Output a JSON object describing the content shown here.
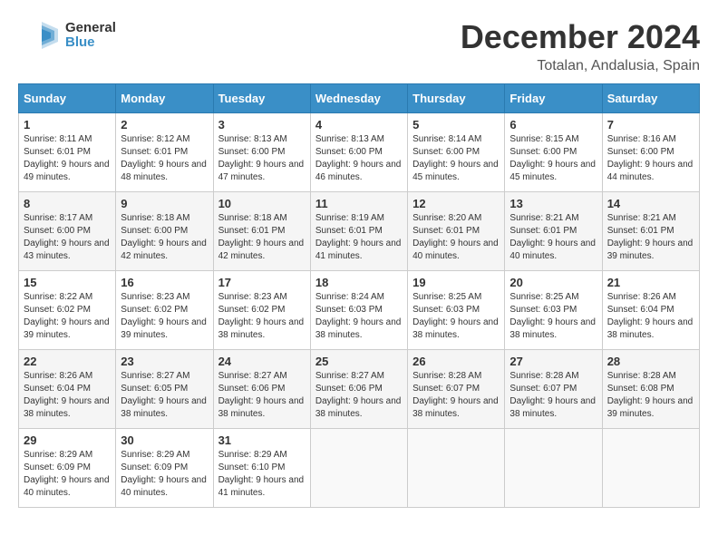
{
  "header": {
    "logo_general": "General",
    "logo_blue": "Blue",
    "month": "December 2024",
    "location": "Totalan, Andalusia, Spain"
  },
  "weekdays": [
    "Sunday",
    "Monday",
    "Tuesday",
    "Wednesday",
    "Thursday",
    "Friday",
    "Saturday"
  ],
  "weeks": [
    [
      {
        "day": "1",
        "sunrise": "8:11 AM",
        "sunset": "6:01 PM",
        "daylight": "9 hours and 49 minutes."
      },
      {
        "day": "2",
        "sunrise": "8:12 AM",
        "sunset": "6:01 PM",
        "daylight": "9 hours and 48 minutes."
      },
      {
        "day": "3",
        "sunrise": "8:13 AM",
        "sunset": "6:00 PM",
        "daylight": "9 hours and 47 minutes."
      },
      {
        "day": "4",
        "sunrise": "8:13 AM",
        "sunset": "6:00 PM",
        "daylight": "9 hours and 46 minutes."
      },
      {
        "day": "5",
        "sunrise": "8:14 AM",
        "sunset": "6:00 PM",
        "daylight": "9 hours and 45 minutes."
      },
      {
        "day": "6",
        "sunrise": "8:15 AM",
        "sunset": "6:00 PM",
        "daylight": "9 hours and 45 minutes."
      },
      {
        "day": "7",
        "sunrise": "8:16 AM",
        "sunset": "6:00 PM",
        "daylight": "9 hours and 44 minutes."
      }
    ],
    [
      {
        "day": "8",
        "sunrise": "8:17 AM",
        "sunset": "6:00 PM",
        "daylight": "9 hours and 43 minutes."
      },
      {
        "day": "9",
        "sunrise": "8:18 AM",
        "sunset": "6:00 PM",
        "daylight": "9 hours and 42 minutes."
      },
      {
        "day": "10",
        "sunrise": "8:18 AM",
        "sunset": "6:01 PM",
        "daylight": "9 hours and 42 minutes."
      },
      {
        "day": "11",
        "sunrise": "8:19 AM",
        "sunset": "6:01 PM",
        "daylight": "9 hours and 41 minutes."
      },
      {
        "day": "12",
        "sunrise": "8:20 AM",
        "sunset": "6:01 PM",
        "daylight": "9 hours and 40 minutes."
      },
      {
        "day": "13",
        "sunrise": "8:21 AM",
        "sunset": "6:01 PM",
        "daylight": "9 hours and 40 minutes."
      },
      {
        "day": "14",
        "sunrise": "8:21 AM",
        "sunset": "6:01 PM",
        "daylight": "9 hours and 39 minutes."
      }
    ],
    [
      {
        "day": "15",
        "sunrise": "8:22 AM",
        "sunset": "6:02 PM",
        "daylight": "9 hours and 39 minutes."
      },
      {
        "day": "16",
        "sunrise": "8:23 AM",
        "sunset": "6:02 PM",
        "daylight": "9 hours and 39 minutes."
      },
      {
        "day": "17",
        "sunrise": "8:23 AM",
        "sunset": "6:02 PM",
        "daylight": "9 hours and 38 minutes."
      },
      {
        "day": "18",
        "sunrise": "8:24 AM",
        "sunset": "6:03 PM",
        "daylight": "9 hours and 38 minutes."
      },
      {
        "day": "19",
        "sunrise": "8:25 AM",
        "sunset": "6:03 PM",
        "daylight": "9 hours and 38 minutes."
      },
      {
        "day": "20",
        "sunrise": "8:25 AM",
        "sunset": "6:03 PM",
        "daylight": "9 hours and 38 minutes."
      },
      {
        "day": "21",
        "sunrise": "8:26 AM",
        "sunset": "6:04 PM",
        "daylight": "9 hours and 38 minutes."
      }
    ],
    [
      {
        "day": "22",
        "sunrise": "8:26 AM",
        "sunset": "6:04 PM",
        "daylight": "9 hours and 38 minutes."
      },
      {
        "day": "23",
        "sunrise": "8:27 AM",
        "sunset": "6:05 PM",
        "daylight": "9 hours and 38 minutes."
      },
      {
        "day": "24",
        "sunrise": "8:27 AM",
        "sunset": "6:06 PM",
        "daylight": "9 hours and 38 minutes."
      },
      {
        "day": "25",
        "sunrise": "8:27 AM",
        "sunset": "6:06 PM",
        "daylight": "9 hours and 38 minutes."
      },
      {
        "day": "26",
        "sunrise": "8:28 AM",
        "sunset": "6:07 PM",
        "daylight": "9 hours and 38 minutes."
      },
      {
        "day": "27",
        "sunrise": "8:28 AM",
        "sunset": "6:07 PM",
        "daylight": "9 hours and 38 minutes."
      },
      {
        "day": "28",
        "sunrise": "8:28 AM",
        "sunset": "6:08 PM",
        "daylight": "9 hours and 39 minutes."
      }
    ],
    [
      {
        "day": "29",
        "sunrise": "8:29 AM",
        "sunset": "6:09 PM",
        "daylight": "9 hours and 40 minutes."
      },
      {
        "day": "30",
        "sunrise": "8:29 AM",
        "sunset": "6:09 PM",
        "daylight": "9 hours and 40 minutes."
      },
      {
        "day": "31",
        "sunrise": "8:29 AM",
        "sunset": "6:10 PM",
        "daylight": "9 hours and 41 minutes."
      },
      null,
      null,
      null,
      null
    ]
  ]
}
